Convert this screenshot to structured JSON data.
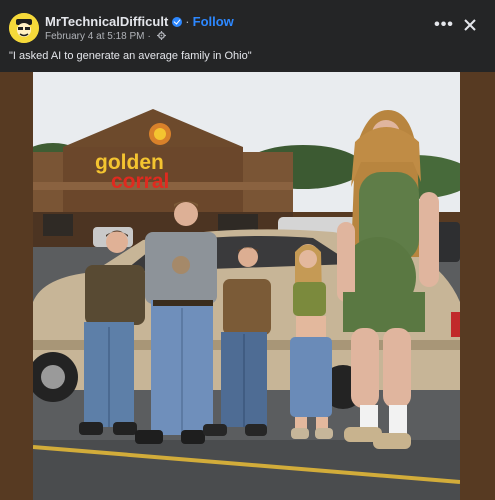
{
  "post": {
    "author_name": "MrTechnicalDifficult",
    "follow_label": "Follow",
    "separator": "·",
    "timestamp": "February 4 at 5:18 PM",
    "caption": "\"I asked AI to generate an average family in Ohio\""
  },
  "photo": {
    "sign_line1": "golden",
    "sign_line2": "corral"
  },
  "icons": {
    "verified": "verified-badge-icon",
    "privacy": "gear-icon",
    "more": "more-options-icon",
    "close": "close-icon"
  },
  "colors": {
    "background": "#242526",
    "accent": "#2d88ff",
    "text_primary": "#e4e6eb",
    "text_secondary": "#b0b3b8",
    "photo_border": "#573a22",
    "sign_yellow": "#f4c430",
    "sign_red": "#e02a1f"
  }
}
